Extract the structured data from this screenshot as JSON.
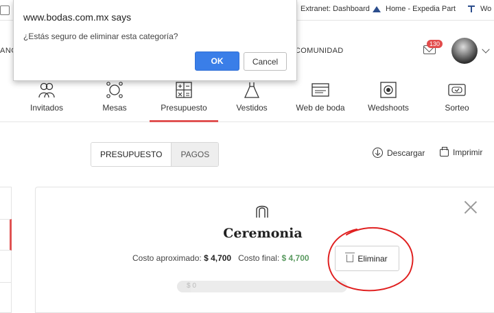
{
  "bookmarks": [
    {
      "label": "Extranet: Dashboard",
      "icon": "extranet-icon"
    },
    {
      "label": "Home - Expedia Part",
      "icon": "expedia-icon"
    },
    {
      "label": "Wo",
      "icon": "bookmark-icon"
    }
  ],
  "header": {
    "nav_left_fragment": "ANC",
    "nav_comunidad": "COMUNIDAD",
    "notifications_count": "130"
  },
  "tools": [
    {
      "label": "Invitados",
      "icon": "guests-icon"
    },
    {
      "label": "Mesas",
      "icon": "tables-icon"
    },
    {
      "label": "Presupuesto",
      "icon": "calculator-icon",
      "active": true
    },
    {
      "label": "Vestidos",
      "icon": "dress-icon"
    },
    {
      "label": "Web de boda",
      "icon": "website-icon"
    },
    {
      "label": "Wedshoots",
      "icon": "camera-icon"
    },
    {
      "label": "Sorteo",
      "icon": "ticket-icon"
    }
  ],
  "subtabs": {
    "presupuesto": "PRESUPUESTO",
    "pagos": "PAGOS"
  },
  "actions": {
    "download": "Descargar",
    "print": "Imprimir"
  },
  "category": {
    "title": "Ceremonia",
    "approx_label": "Costo aproximado:",
    "approx_value": "$ 4,700",
    "final_label": "Costo final:",
    "final_value": "$ 4,700",
    "delete_label": "Eliminar",
    "progress_text": "$ 0"
  },
  "dialog": {
    "title": "www.bodas.com.mx says",
    "message": "¿Estás seguro de eliminar esta categoría?",
    "ok_label": "OK",
    "cancel_label": "Cancel"
  },
  "colors": {
    "accent": "#e05252",
    "ok_button": "#3a7ee8",
    "final_cost": "#5a9a60",
    "annotation": "#e02020"
  }
}
